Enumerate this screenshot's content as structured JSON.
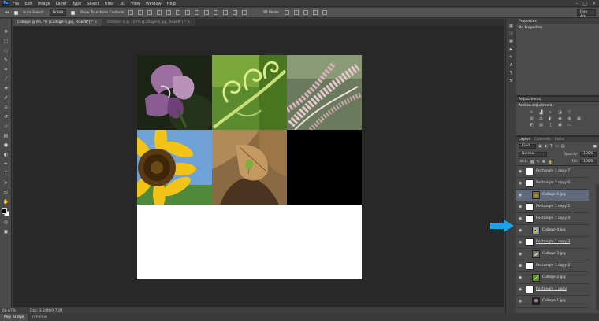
{
  "app": {
    "logo": "Ps",
    "menus": [
      "File",
      "Edit",
      "Image",
      "Layer",
      "Type",
      "Select",
      "Filter",
      "3D",
      "View",
      "Window",
      "Help"
    ],
    "window_controls": [
      "–",
      "□",
      "✕"
    ]
  },
  "options_bar": {
    "auto_select_label": "Auto-Select:",
    "auto_select_value": "Group",
    "show_transform_label": "Show Transform Controls",
    "mode_3d_label": "3D Mode:",
    "workspace_value": "Fine Art"
  },
  "tabs": [
    {
      "label": "Collage @ 66.7% (Collage-6.jpg, RGB/8*) *  ×",
      "active": true
    },
    {
      "label": "Untitled-1 @ 100% (Collage-6.jpg, RGB/8*) *  ×",
      "active": false
    }
  ],
  "status": {
    "zoom": "66.67%",
    "doc_size": "Doc: 3.24M/9.72M"
  },
  "bottom_tabs": [
    {
      "label": "Mini Bridge",
      "active": true
    },
    {
      "label": "Timeline",
      "active": false
    }
  ],
  "panels": {
    "properties_tab": "Properties",
    "properties_text": "No Properties",
    "adjustments_tab": "Adjustments",
    "adjustments_title": "Add an adjustment",
    "layers_tabs": [
      "Layers",
      "Channels",
      "Paths"
    ],
    "filter_kind": "Kind",
    "blend_mode": "Normal",
    "opacity_label": "Opacity:",
    "opacity_value": "100%",
    "lock_label": "Lock:",
    "fill_label": "Fill:",
    "fill_value": "100%"
  },
  "layers": [
    {
      "name": "Rectangle 1 copy 7",
      "indent": false,
      "selected": false,
      "underlined": false,
      "thumb": "white"
    },
    {
      "name": "Rectangle 1 copy 6",
      "indent": false,
      "selected": false,
      "underlined": false,
      "thumb": "white"
    },
    {
      "name": "Collage-6.jpg",
      "indent": true,
      "selected": true,
      "underlined": false,
      "thumb": "leaf"
    },
    {
      "name": "Rectangle 1 copy 5",
      "indent": false,
      "selected": false,
      "underlined": true,
      "thumb": "white"
    },
    {
      "name": "Rectangle 1 copy 4",
      "indent": false,
      "selected": false,
      "underlined": false,
      "thumb": "white"
    },
    {
      "name": "Collage-4.jpg",
      "indent": true,
      "selected": false,
      "underlined": false,
      "thumb": "sunflower"
    },
    {
      "name": "Rectangle 1 copy 3",
      "indent": false,
      "selected": false,
      "underlined": true,
      "thumb": "white"
    },
    {
      "name": "Collage-3.jpg",
      "indent": true,
      "selected": false,
      "underlined": false,
      "thumb": "grass"
    },
    {
      "name": "Rectangle 1 copy 2",
      "indent": false,
      "selected": false,
      "underlined": true,
      "thumb": "white"
    },
    {
      "name": "Collage-2.jpg",
      "indent": true,
      "selected": false,
      "underlined": false,
      "thumb": "fern"
    },
    {
      "name": "Rectangle 1 copy",
      "indent": false,
      "selected": false,
      "underlined": true,
      "thumb": "white"
    },
    {
      "name": "Collage-1.jpg",
      "indent": true,
      "selected": false,
      "underlined": false,
      "thumb": "iris"
    }
  ],
  "colors": {
    "annotation_arrow": "#1aa3e8",
    "selected_layer": "#5f6b7d"
  }
}
